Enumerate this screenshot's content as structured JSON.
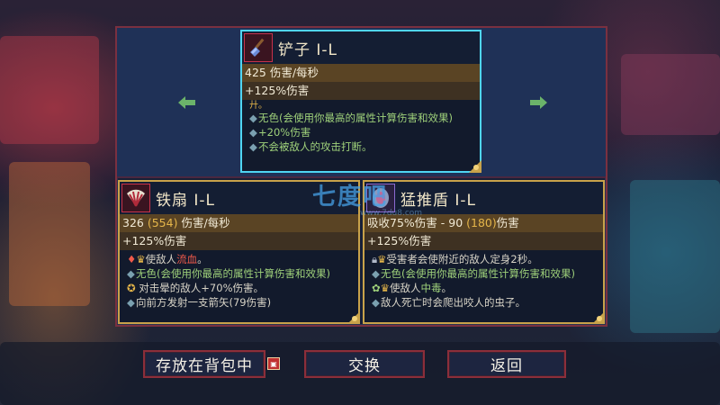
{
  "colors": {
    "panel_border": "#7a3040",
    "card_border_gold": "#c8a24a",
    "card_border_selected": "#4fd5f2",
    "stat_band": "#5a4424",
    "green_text": "#9ed07a",
    "red_text": "#ef5a4a",
    "button_border": "#8c2e3a"
  },
  "nav": {
    "left_icon": "arrow-left-icon",
    "right_icon": "arrow-right-icon"
  },
  "top_card": {
    "icon": "shovel-icon",
    "title": "铲子 I-L",
    "stat": "425 伤害/每秒",
    "bonus": "+125%伤害",
    "partial": "廾。",
    "lines": [
      "无色(会使用你最高的属性计算伤害和效果)",
      "+20%伤害",
      "不会被敌人的攻击打断。"
    ]
  },
  "left_card": {
    "icon": "iron-fan-icon",
    "title": "铁扇 I-L",
    "stat_value": "326",
    "stat_alt": "(554)",
    "stat_unit": "伤害/每秒",
    "bonus": "+125%伤害",
    "line1_prefix": "使敌人",
    "line1_red": "流血",
    "line1_suffix": "。",
    "line2": "无色(会使用你最高的属性计算伤害和效果)",
    "line3": "对击晕的敌人+70%伤害。",
    "line4": "向前方发射一支箭矢(79伤害)"
  },
  "right_card": {
    "icon": "shield-icon",
    "title": "猛推盾 I-L",
    "stat_prefix": "吸收75%伤害 - 90",
    "stat_alt": "(180)",
    "stat_suffix": "伤害",
    "bonus": "+125%伤害",
    "line1": "受害者会使附近的敌人定身2秒。",
    "line2": "无色(会使用你最高的属性计算伤害和效果)",
    "line3_prefix": "使敌人",
    "line3_green": "中毒",
    "line3_suffix": "。",
    "line4": "敌人死亡时会爬出咬人的虫子。"
  },
  "watermark": {
    "text": "七度吧",
    "url": "www.7du8.com"
  },
  "buttons": {
    "store": "存放在背包中",
    "swap": "交换",
    "back": "返回",
    "store_key_icon": "controller-button-icon"
  }
}
